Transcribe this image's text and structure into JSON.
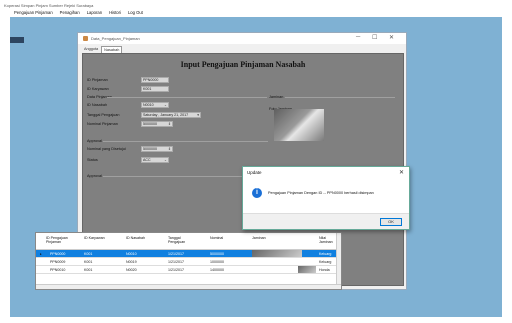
{
  "main_window": {
    "title": "Koperasi Simpan Pinjam Sumber Rejeki Surabaya"
  },
  "menubar": [
    "Pengajuan Pinjaman",
    "Penagihan",
    "Laporan",
    "Histori",
    "Log Out"
  ],
  "background_text": "a",
  "child_window": {
    "title": "Data_Pengajuan_Pinjaman",
    "controls": {
      "minimize": "─",
      "maximize": "☐",
      "close": "✕"
    }
  },
  "tabs": [
    {
      "label": "Anggota"
    },
    {
      "label": "Nasabah"
    }
  ],
  "form": {
    "title": "Input Pengajuan Pinjaman Nasabah",
    "id_pinjaman": {
      "label": "ID Pinjaman",
      "value": "PPN0000"
    },
    "id_karyawan": {
      "label": "ID Karyawan",
      "value": "K001"
    },
    "section_data_pinjaman": "Data Pinjaman",
    "id_nasabah": {
      "label": "ID Nasabah",
      "value": "N0010"
    },
    "tanggal_pengajuan": {
      "label": "Tanggal Pengajuan",
      "value": "Saturday ,   January  21, 2017"
    },
    "nominal_pinjaman": {
      "label": "Nominal Pinjaman",
      "value": "5000000"
    },
    "jaminan_section": "Jaminan",
    "foto_jaminan_label": "Foto Jaminan",
    "section_approval": "Approval",
    "nominal_disetujui": {
      "label": "Nominal yang Disetujui",
      "value": "5000000"
    },
    "status": {
      "label": "Status",
      "value": "ACC"
    },
    "section_approval_b": "Approval"
  },
  "grid": {
    "columns": [
      "ID Pengajuan Pinjaman",
      "ID Karyawan",
      "ID Nasabah",
      "Tanggal Pengajuan",
      "Nominal",
      "Jaminan",
      "Nilai Jaminan"
    ],
    "rows": [
      {
        "id_pengajuan": "PPN0000",
        "id_karyawan": "K001",
        "id_nasabah": "N0010",
        "tanggal": "1/21/2017",
        "nominal": "5000000",
        "nilai": "Keluarg",
        "selected": true
      },
      {
        "id_pengajuan": "PPN0009",
        "id_karyawan": "K001",
        "id_nasabah": "N0019",
        "tanggal": "1/21/2017",
        "nominal": "1000000",
        "nilai": "Keluarg",
        "selected": false
      },
      {
        "id_pengajuan": "PPN0010",
        "id_karyawan": "K001",
        "id_nasabah": "N0020",
        "tanggal": "1/21/2017",
        "nominal": "1400000",
        "nilai": "Honda",
        "selected": false
      }
    ]
  },
  "dialog": {
    "title": "Update",
    "close": "✕",
    "icon": "i",
    "message": "Pengajuan Pinjaman Dengan ID -- PPN0000 berhasil disimpan",
    "ok_label": "OK"
  }
}
